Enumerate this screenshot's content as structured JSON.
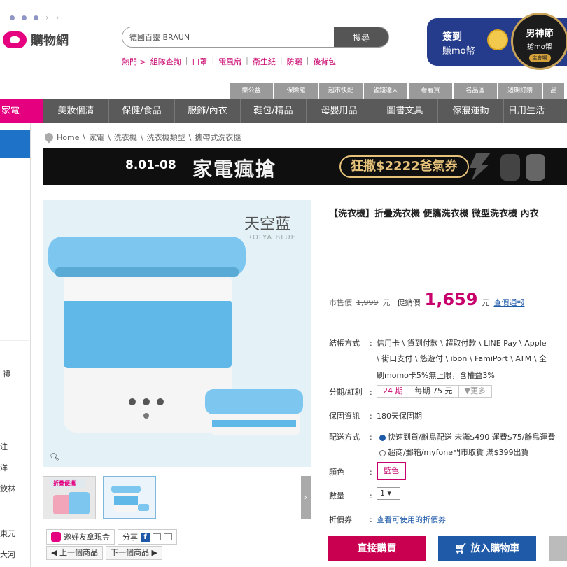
{
  "header": {
    "logo_text": "購物網",
    "search_value": "德國百靈 BRAUN",
    "search_button": "搜尋",
    "hot_label": "熱門 >",
    "hot_terms": [
      "組隊查詢",
      "口罩",
      "電風扇",
      "衛生紙",
      "防曬",
      "後背包"
    ],
    "promo_line1": "簽到",
    "promo_line2": "賺mo幣",
    "badge_title": "男神節",
    "badge_sub": "搶mo幣",
    "badge_tag": "主會場"
  },
  "tabs": [
    "樂公益",
    "保險館",
    "超市快配",
    "省錢達人",
    "看看買",
    "名品區",
    "週期訂購",
    "品"
  ],
  "categories": {
    "active": "家電",
    "items": [
      "美妝個清",
      "保健/食品",
      "服飾/內衣",
      "鞋包/精品",
      "母嬰用品",
      "圖書文具",
      "傢寢運動",
      "日用生活"
    ]
  },
  "left_fragments": [
    "禮",
    "注",
    "洋",
    "欽林",
    "東元",
    "大河"
  ],
  "breadcrumb": [
    "Home",
    "家電",
    "洗衣機",
    "洗衣機類型",
    "攜帶式洗衣機"
  ],
  "banner": {
    "dates": "8.01-08",
    "main": "家電瘋搶",
    "pill": "狂撒$2222爸氣券"
  },
  "product_image": {
    "tag_cn": "天空蓝",
    "tag_en": "ROLYA BLUE",
    "thumb_label": "折疊便攜"
  },
  "share": {
    "recommend": "邀好友拿現金",
    "share_label": "分享",
    "fb": "f",
    "prev": "◀ 上一個商品",
    "next": "下一個商品 ▶"
  },
  "product": {
    "title": "【洗衣機】折疊洗衣機 便攜洗衣機 微型洗衣機 內衣",
    "market_label": "市售價",
    "market_price": "1,999",
    "unit": "元",
    "promo_label": "促銷價",
    "promo_price": "1,659",
    "promo_unit": "元",
    "report_link": "查價通報"
  },
  "details": {
    "payment_label": "結帳方式",
    "payment_line1": "信用卡 \\ 貨到付款 \\ 超取付款 \\ LINE Pay \\ Apple",
    "payment_line2": "\\ 街口支付 \\ 悠遊付 \\ ibon \\ FamiPort \\ ATM \\ 全",
    "payment_line3": "刷momo卡5%無上限，含權益3%",
    "installment_label": "分期/紅利",
    "installment_months": "24 期",
    "installment_each": "每期 75 元",
    "installment_more": "▼更多",
    "warranty_label": "保固資訊",
    "warranty_value": "180天保固期",
    "delivery_label": "配送方式",
    "delivery_opt1": "快速到貨/離島配送  未滿$490 運費$75/離島運費",
    "delivery_opt2": "超商/郵箱/myfone門市取貨  滿$399出貨",
    "color_label": "顏色",
    "color_value": "藍色",
    "qty_label": "數量",
    "qty_value": "1 ▾",
    "coupon_label": "折價券",
    "coupon_link": "查看可使用的折價券"
  },
  "actions": {
    "buy": "直接購買",
    "cart": "放入購物車"
  }
}
